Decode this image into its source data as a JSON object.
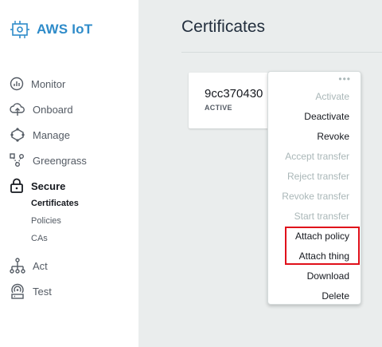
{
  "app": {
    "logo_text": "AWS IoT",
    "brand_color": "#2e8bc9"
  },
  "sidebar": {
    "items": [
      {
        "label": "Monitor",
        "icon": "monitor-gauge-icon",
        "active": false
      },
      {
        "label": "Onboard",
        "icon": "onboard-cloud-icon",
        "active": false
      },
      {
        "label": "Manage",
        "icon": "manage-nodes-icon",
        "active": false
      },
      {
        "label": "Greengrass",
        "icon": "greengrass-icon",
        "active": false
      },
      {
        "label": "Secure",
        "icon": "lock-icon",
        "active": true
      },
      {
        "label": "Act",
        "icon": "act-network-icon",
        "active": false
      },
      {
        "label": "Test",
        "icon": "test-signal-icon",
        "active": false
      }
    ],
    "secure_sub": [
      {
        "label": "Certificates",
        "active": true
      },
      {
        "label": "Policies",
        "active": false
      },
      {
        "label": "CAs",
        "active": false
      }
    ]
  },
  "main": {
    "title": "Certificates",
    "card": {
      "id": "9cc370430",
      "status": "ACTIVE"
    }
  },
  "menu": {
    "dots": "•••",
    "items": [
      {
        "label": "Activate",
        "disabled": true
      },
      {
        "label": "Deactivate",
        "disabled": false
      },
      {
        "label": "Revoke",
        "disabled": false
      },
      {
        "label": "Accept transfer",
        "disabled": true
      },
      {
        "label": "Reject transfer",
        "disabled": true
      },
      {
        "label": "Revoke transfer",
        "disabled": true
      },
      {
        "label": "Start transfer",
        "disabled": true
      },
      {
        "label": "Attach policy",
        "disabled": false
      },
      {
        "label": "Attach thing",
        "disabled": false
      },
      {
        "label": "Download",
        "disabled": false
      },
      {
        "label": "Delete",
        "disabled": false
      }
    ],
    "highlight_color": "#e0101a"
  }
}
